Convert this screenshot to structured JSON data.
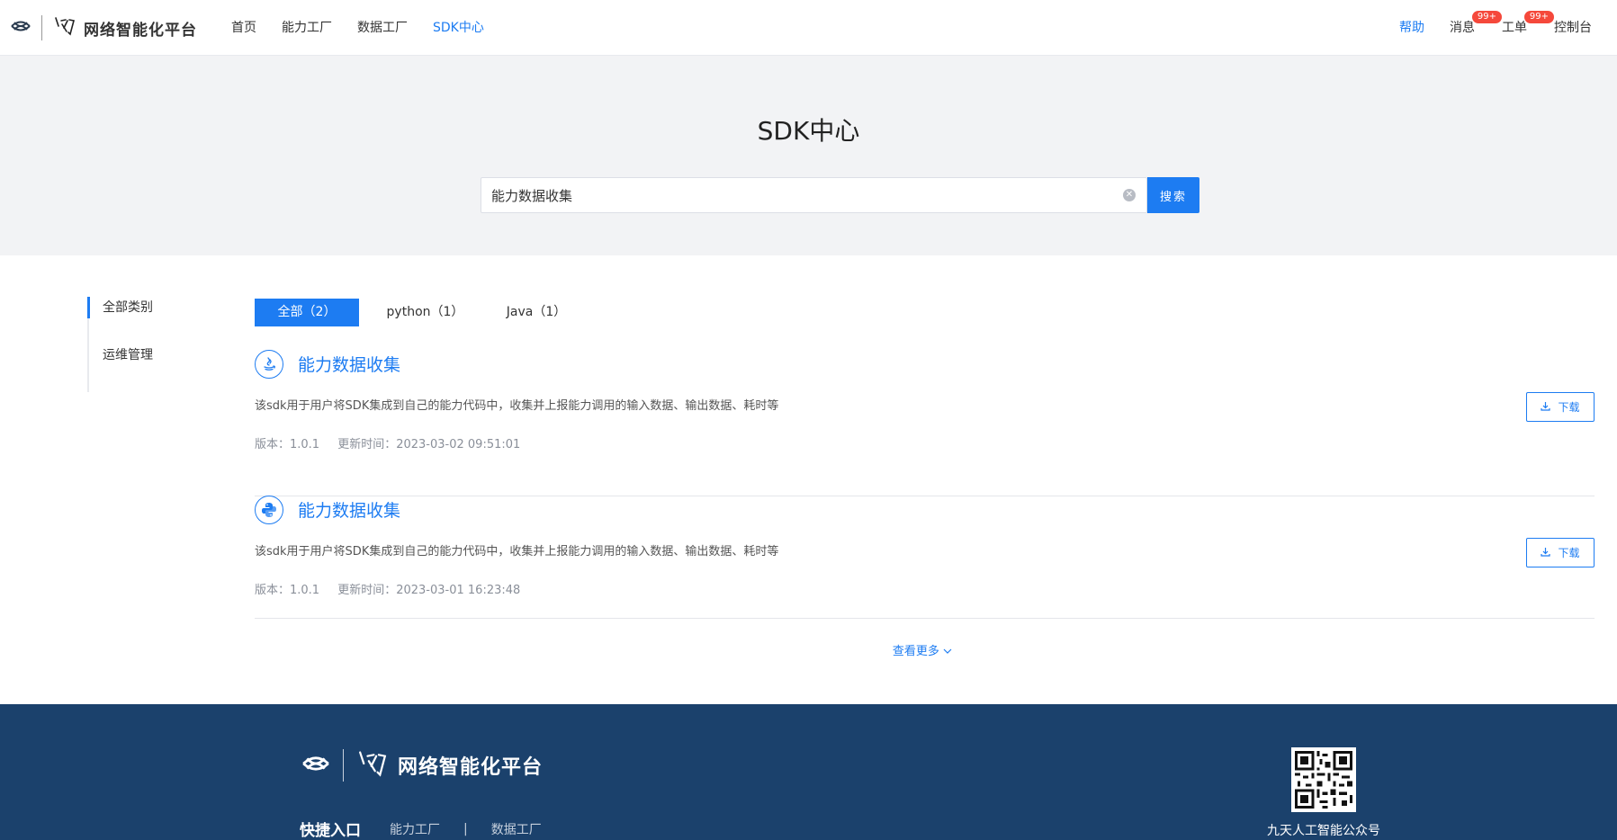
{
  "header": {
    "platform_name": "网络智能化平台",
    "nav": [
      "首页",
      "能力工厂",
      "数据工厂",
      "SDK中心"
    ],
    "active_nav": "SDK中心",
    "help": "帮助",
    "messages": {
      "label": "消息",
      "badge": "99+"
    },
    "tickets": {
      "label": "工单",
      "badge": "99+"
    },
    "console": "控制台"
  },
  "hero": {
    "title": "SDK中心",
    "search_value": "能力数据收集",
    "search_button": "搜索"
  },
  "sidebar": {
    "items": [
      "全部类别",
      "运维管理"
    ]
  },
  "tabs": [
    "全部（2）",
    "python（1）",
    "Java（1）"
  ],
  "sdk_list": [
    {
      "icon": "java-icon",
      "name": "能力数据收集",
      "description": "该sdk用于用户将SDK集成到自己的能力代码中，收集并上报能力调用的输入数据、输出数据、耗时等",
      "version": "版本：1.0.1",
      "updated": "更新时间：2023-03-02 09:51:01",
      "download": "下载"
    },
    {
      "icon": "python-icon",
      "name": "能力数据收集",
      "description": "该sdk用于用户将SDK集成到自己的能力代码中，收集并上报能力调用的输入数据、输出数据、耗时等",
      "version": "版本：1.0.1",
      "updated": "更新时间：2023-03-01 16:23:48",
      "download": "下载"
    }
  ],
  "more": "查看更多",
  "footer": {
    "platform_name": "网络智能化平台",
    "quick_title": "快捷入口",
    "links": [
      "能力工厂",
      "数据工厂"
    ],
    "link_separator": "|",
    "qr_label": "九天人工智能公众号"
  },
  "colors": {
    "primary": "#1d7cf2",
    "footer_bg": "#1b416c",
    "hero_bg": "#f2f3f5",
    "badge": "#f5483b"
  }
}
